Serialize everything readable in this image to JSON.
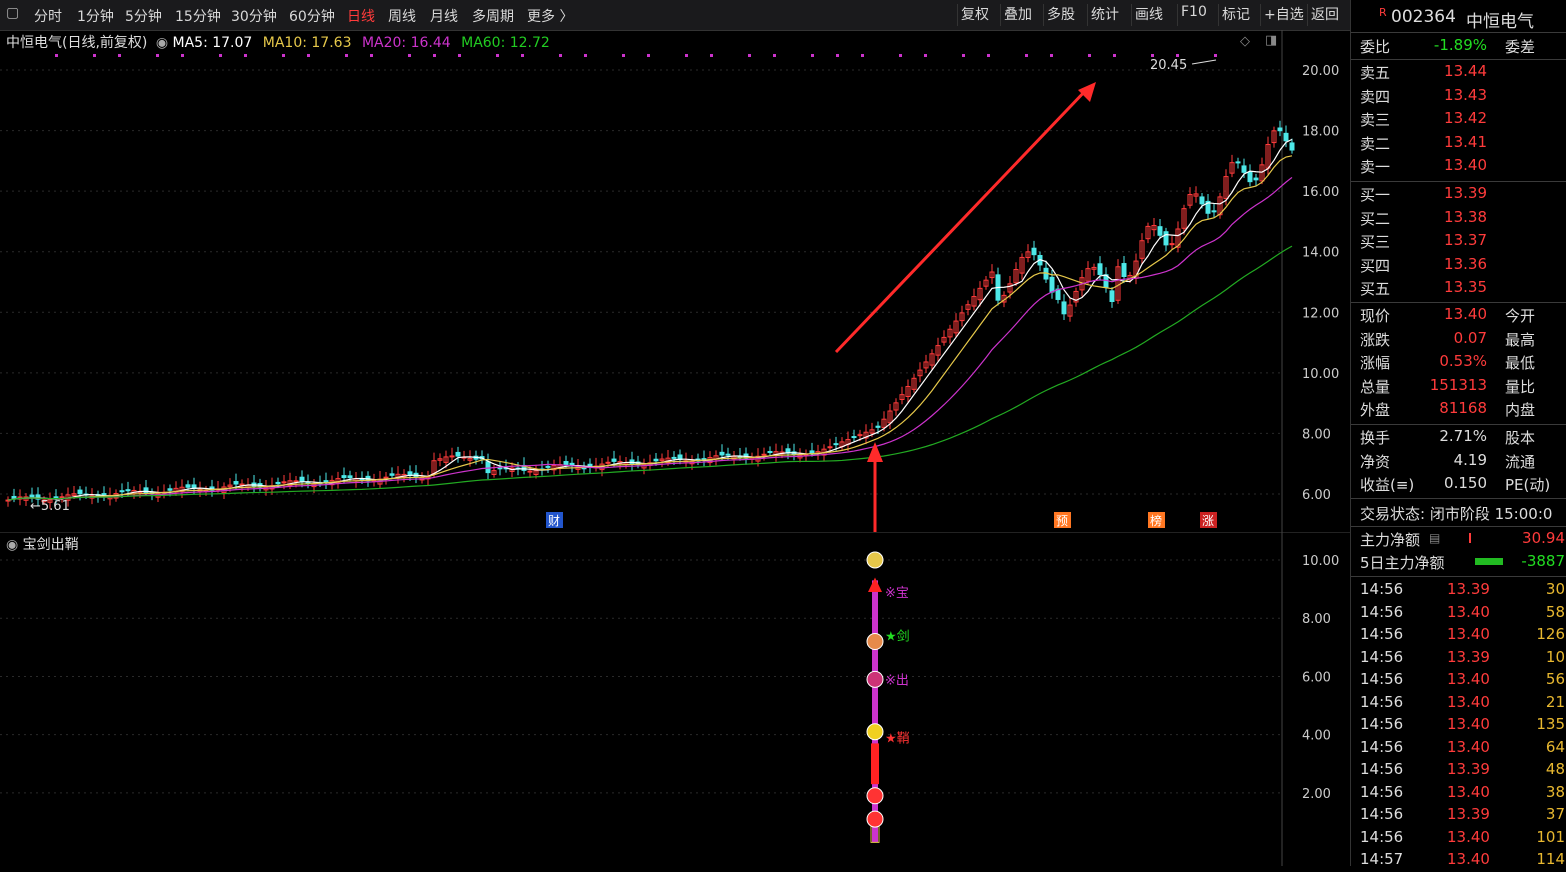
{
  "toolbar": {
    "periods": [
      "分时",
      "1分钟",
      "5分钟",
      "15分钟",
      "30分钟",
      "60分钟",
      "日线",
      "周线",
      "月线",
      "多周期",
      "更多 〉"
    ],
    "active_period": "日线",
    "right_buttons": [
      "复权",
      "叠加",
      "多股",
      "统计",
      "画线",
      "F10",
      "标记",
      "+自选",
      "返回"
    ]
  },
  "main_chart": {
    "title": "中恒电气(日线,前复权)",
    "ma5": "MA5: 17.07",
    "ma10": "MA10: 17.63",
    "ma20": "MA20: 16.44",
    "ma60": "MA60: 12.72",
    "high_label": "20.45",
    "low_label": "5.61",
    "y_ticks": [
      "20.00",
      "18.00",
      "16.00",
      "14.00",
      "12.00",
      "10.00",
      "8.00",
      "6.00"
    ],
    "event_tags": [
      "财",
      "预",
      "榜",
      "涨"
    ],
    "colors": {
      "up": "#ff3b3b",
      "down": "#4de8e8",
      "ma5": "#ffffff",
      "ma10": "#e6c84a",
      "ma20": "#cc33cc",
      "ma60": "#22aa22",
      "arrow": "#ff2a2a"
    }
  },
  "sub_chart": {
    "title": "宝剑出鞘",
    "y_ticks": [
      "10.00",
      "8.00",
      "6.00",
      "4.00",
      "2.00"
    ],
    "signals": [
      "※宝",
      "★剑",
      "※出",
      "★鞘"
    ]
  },
  "panel": {
    "stock_badge": "R",
    "stock_code": "002364",
    "stock_name": "中恒电气",
    "weibi_label": "委比",
    "weibi_value": "-1.89%",
    "weicha_label": "委差",
    "asks": [
      {
        "label": "卖五",
        "price": "13.44"
      },
      {
        "label": "卖四",
        "price": "13.43"
      },
      {
        "label": "卖三",
        "price": "13.42"
      },
      {
        "label": "卖二",
        "price": "13.41"
      },
      {
        "label": "卖一",
        "price": "13.40"
      }
    ],
    "bids": [
      {
        "label": "买一",
        "price": "13.39"
      },
      {
        "label": "买二",
        "price": "13.38"
      },
      {
        "label": "买三",
        "price": "13.37"
      },
      {
        "label": "买四",
        "price": "13.36"
      },
      {
        "label": "买五",
        "price": "13.35"
      }
    ],
    "quote_rows": [
      {
        "l": "现价",
        "v": "13.40",
        "r": "今开"
      },
      {
        "l": "涨跌",
        "v": "0.07",
        "r": "最高"
      },
      {
        "l": "涨幅",
        "v": "0.53%",
        "r": "最低"
      },
      {
        "l": "总量",
        "v": "151313",
        "r": "量比"
      },
      {
        "l": "外盘",
        "v": "81168",
        "r": "内盘"
      }
    ],
    "stat_rows": [
      {
        "l": "换手",
        "v": "2.71%",
        "r": "股本"
      },
      {
        "l": "净资",
        "v": "4.19",
        "r": "流通"
      },
      {
        "l": "收益(≡)",
        "v": "0.150",
        "r": "PE(动)"
      }
    ],
    "trade_status": "交易状态: 闭市阶段 15:00:0",
    "main_net_label": "主力净额",
    "main_net_value": "30.94",
    "five_day_label": "5日主力净额",
    "five_day_value": "-3887",
    "ticks": [
      {
        "t": "14:56",
        "p": "13.39",
        "v": "30"
      },
      {
        "t": "14:56",
        "p": "13.40",
        "v": "58"
      },
      {
        "t": "14:56",
        "p": "13.40",
        "v": "126"
      },
      {
        "t": "14:56",
        "p": "13.39",
        "v": "10"
      },
      {
        "t": "14:56",
        "p": "13.40",
        "v": "56"
      },
      {
        "t": "14:56",
        "p": "13.40",
        "v": "21"
      },
      {
        "t": "14:56",
        "p": "13.40",
        "v": "135"
      },
      {
        "t": "14:56",
        "p": "13.40",
        "v": "64"
      },
      {
        "t": "14:56",
        "p": "13.39",
        "v": "48"
      },
      {
        "t": "14:56",
        "p": "13.40",
        "v": "38"
      },
      {
        "t": "14:56",
        "p": "13.39",
        "v": "37"
      },
      {
        "t": "14:56",
        "p": "13.40",
        "v": "101"
      },
      {
        "t": "14:57",
        "p": "13.40",
        "v": "114"
      }
    ]
  }
}
